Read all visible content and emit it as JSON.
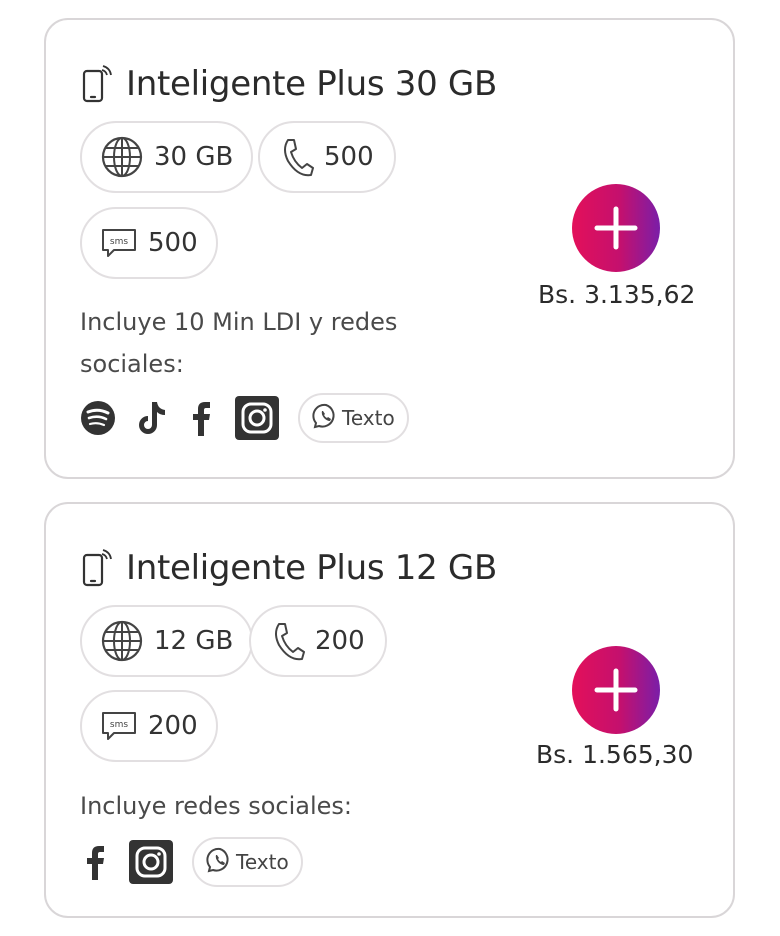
{
  "colors": {
    "accent_start": "#e3105a",
    "accent_end": "#7a1ea8",
    "border": "#d9d6d8"
  },
  "plans": [
    {
      "name": "Inteligente Plus 30 GB",
      "data": "30 GB",
      "minutes": "500",
      "sms": "500",
      "includes": "Incluye 10 Min LDI y redes sociales:",
      "includes_line1": "Incluye 10 Min LDI y redes",
      "includes_line2": "sociales:",
      "social_icons": [
        "spotify-icon",
        "tiktok-icon",
        "facebook-icon",
        "instagram-icon"
      ],
      "whatsapp_label": "Texto",
      "price": "Bs. 3.135,62"
    },
    {
      "name": "Inteligente Plus 12 GB",
      "data": "12 GB",
      "minutes": "200",
      "sms": "200",
      "includes": "Incluye redes sociales:",
      "social_icons": [
        "facebook-icon",
        "instagram-icon"
      ],
      "whatsapp_label": "Texto",
      "price": "Bs. 1.565,30"
    }
  ]
}
